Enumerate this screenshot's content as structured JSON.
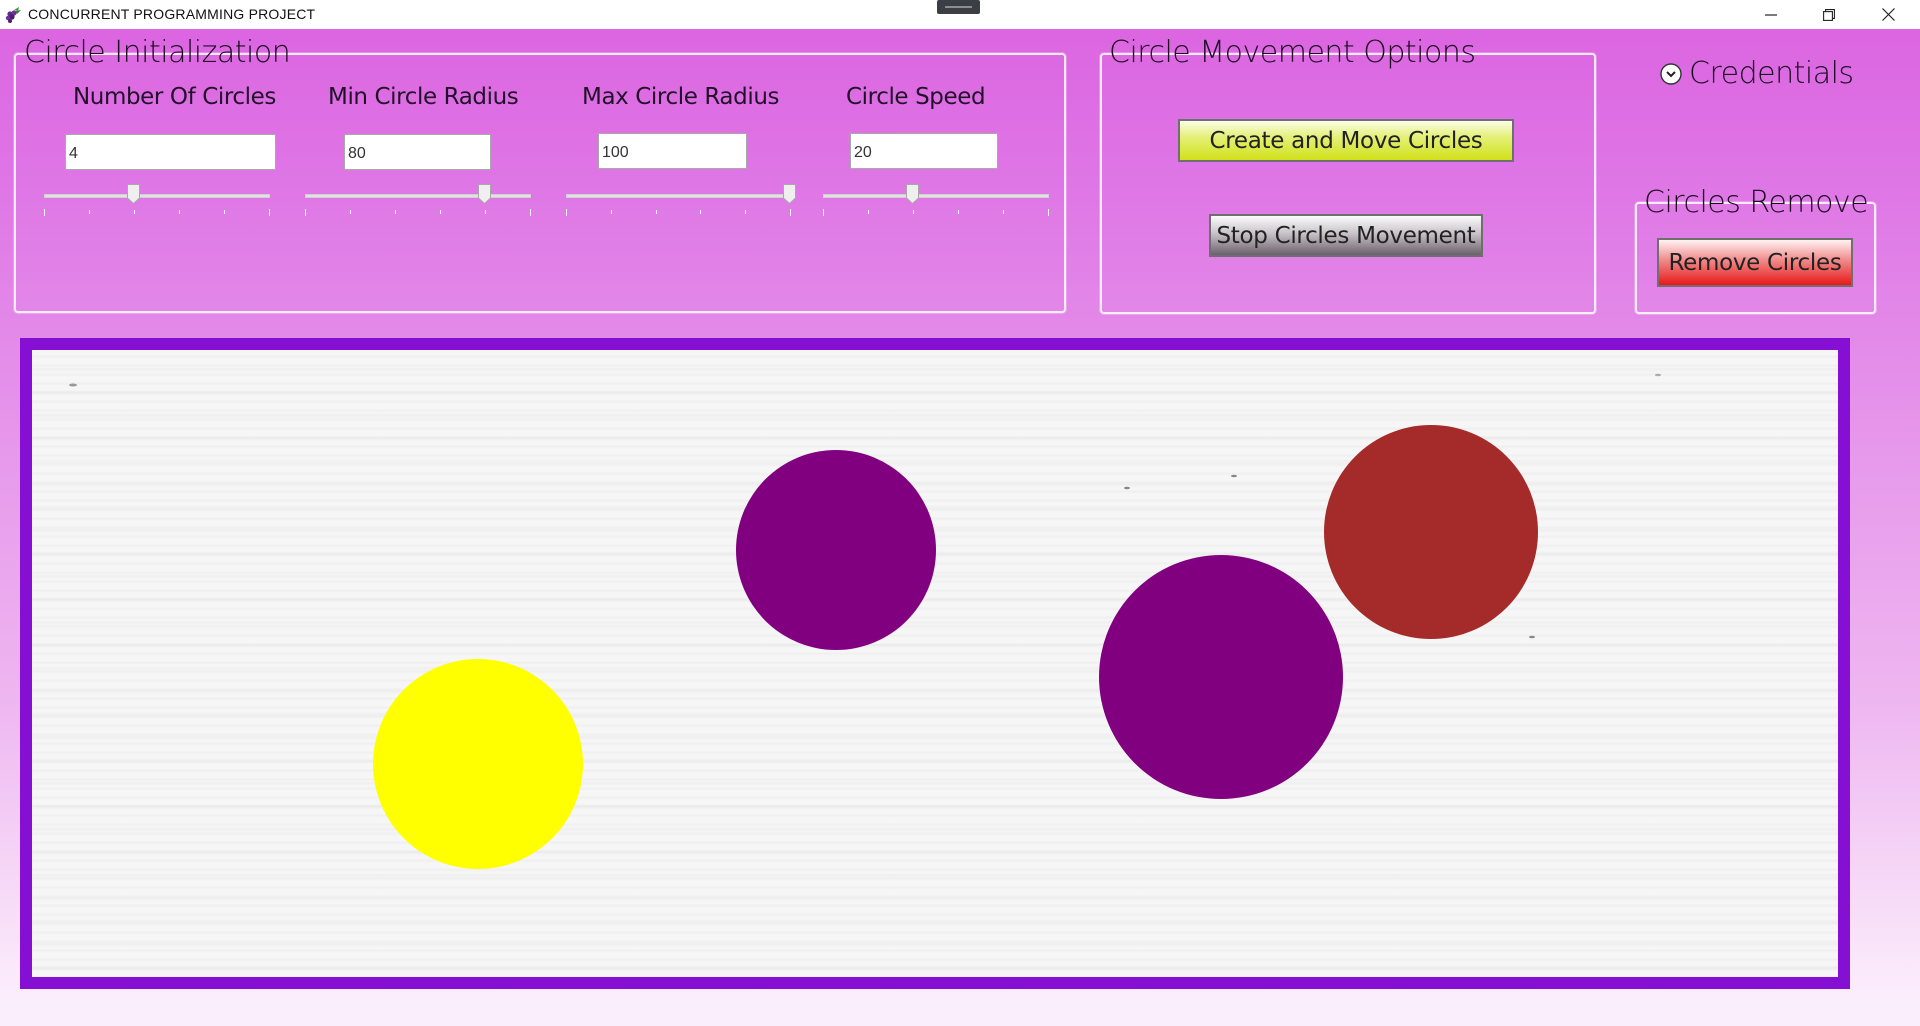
{
  "window": {
    "title": "CONCURRENT PROGRAMMING PROJECT",
    "controls": {
      "minimize": "minimize-icon",
      "restore": "restore-icon",
      "close": "close-icon"
    }
  },
  "initialization": {
    "title": "Circle Initialization",
    "fields": [
      {
        "label": "Number Of Circles",
        "value": "4",
        "slider_fraction": 0.4
      },
      {
        "label": "Min Circle Radius",
        "value": "80",
        "slider_fraction": 0.8
      },
      {
        "label": "Max Circle Radius",
        "value": "100",
        "slider_fraction": 1.0
      },
      {
        "label": "Circle Speed",
        "value": "20",
        "slider_fraction": 0.4
      }
    ]
  },
  "movement": {
    "title": "Circle Movement Options",
    "create_label": "Create and Move Circles",
    "stop_label": "Stop Circles Movement"
  },
  "credentials": {
    "label": "Credentials",
    "icon": "chevron-down-circle-icon"
  },
  "remove": {
    "title": "Circles Remove",
    "button_label": "Remove Circles"
  },
  "canvas": {
    "circles": [
      {
        "name": "purple-circle-small",
        "color": "#800080"
      },
      {
        "name": "purple-circle-large",
        "color": "#800080"
      },
      {
        "name": "brown-circle",
        "color": "#a52a2a"
      },
      {
        "name": "yellow-circle",
        "color": "#ffff00"
      }
    ]
  },
  "colors": {
    "canvas_border": "#8510d4",
    "create_button": "#d2e11a",
    "stop_button": "#6b606b",
    "remove_button": "#e81818"
  }
}
